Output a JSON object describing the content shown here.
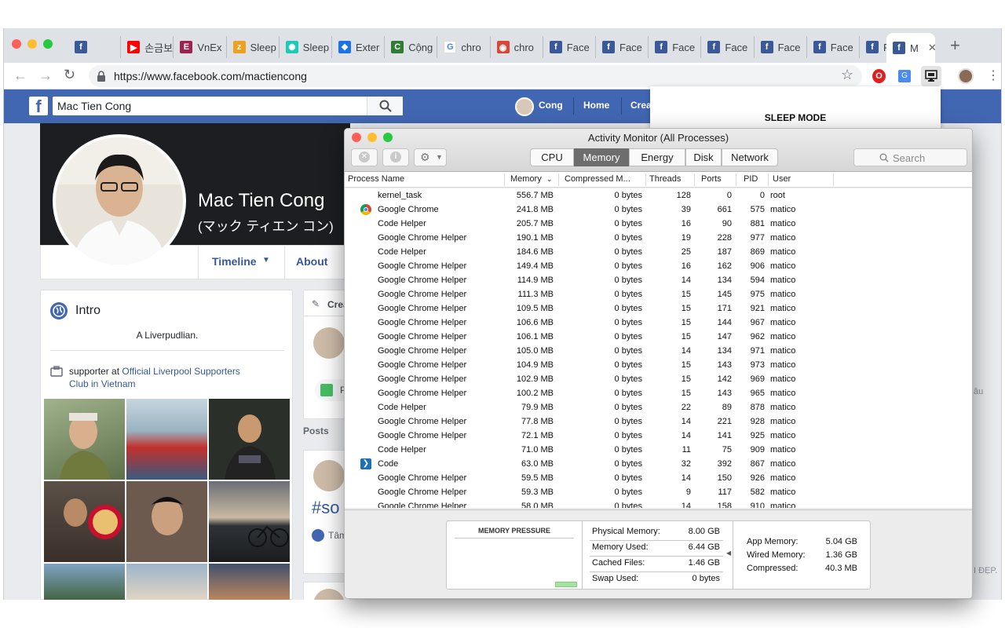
{
  "browser": {
    "tabs": [
      {
        "label": "",
        "icon": "facebook-icon"
      },
      {
        "label": "손금보",
        "icon": "youtube-icon"
      },
      {
        "label": "VnEx",
        "icon": "vnexpress-icon"
      },
      {
        "label": "Sleep",
        "icon": "sleep-app-icon"
      },
      {
        "label": "Sleep",
        "icon": "sleep-extension-icon"
      },
      {
        "label": "Exter",
        "icon": "puzzle-icon"
      },
      {
        "label": "Cộng",
        "icon": "cong-icon"
      },
      {
        "label": "chro",
        "icon": "google-icon"
      },
      {
        "label": "chro",
        "icon": "chrome-icon"
      },
      {
        "label": "Face",
        "icon": "facebook-icon"
      },
      {
        "label": "Face",
        "icon": "facebook-icon"
      },
      {
        "label": "Face",
        "icon": "facebook-icon"
      },
      {
        "label": "Face",
        "icon": "facebook-icon"
      },
      {
        "label": "Face",
        "icon": "facebook-icon"
      },
      {
        "label": "Face",
        "icon": "facebook-icon"
      },
      {
        "label": "Face",
        "icon": "facebook-icon"
      },
      {
        "label": "M",
        "icon": "facebook-icon",
        "active": true
      }
    ],
    "url": "https://www.facebook.com/mactiencong"
  },
  "facebook": {
    "search_value": "Mac Tien Cong",
    "nav": {
      "user": "Cong",
      "home": "Home",
      "create": "Crea"
    },
    "profile_name": "Mac Tien Cong",
    "profile_alt_name": "(マック ティエン コン)",
    "profile_tabs": {
      "timeline": "Timeline",
      "about": "About"
    },
    "intro": {
      "title": "Intro",
      "bio": "A Liverpudlian.",
      "supporter_prefix": "supporter at ",
      "supporter_link_1": "Official Liverpool Supporters",
      "supporter_link_2": "Club in Vietnam"
    },
    "create_post": "Crea",
    "photo_btn": "P",
    "posts_label": "Posts",
    "hashtag": "#so",
    "reaction": "Tâm",
    "right_frag_1": "âu",
    "right_frag_2": "I ĐẸP."
  },
  "sleep_popup": {
    "title": "SLEEP MODE"
  },
  "activity_monitor": {
    "title": "Activity Monitor (All Processes)",
    "tabs": [
      "CPU",
      "Memory",
      "Energy",
      "Disk",
      "Network"
    ],
    "selected_tab": "Memory",
    "search_placeholder": "Search",
    "columns": {
      "process": "Process Name",
      "memory": "Memory",
      "compressed": "Compressed M...",
      "threads": "Threads",
      "ports": "Ports",
      "pid": "PID",
      "user": "User"
    },
    "processes": [
      {
        "name": "kernel_task",
        "memory": "556.7 MB",
        "compressed": "0 bytes",
        "threads": "128",
        "ports": "0",
        "pid": "0",
        "user": "root",
        "icon": ""
      },
      {
        "name": "Google Chrome",
        "memory": "241.8 MB",
        "compressed": "0 bytes",
        "threads": "39",
        "ports": "661",
        "pid": "575",
        "user": "matico",
        "icon": "chrome-icon"
      },
      {
        "name": "Code Helper",
        "memory": "205.7 MB",
        "compressed": "0 bytes",
        "threads": "16",
        "ports": "90",
        "pid": "881",
        "user": "matico",
        "icon": ""
      },
      {
        "name": "Google Chrome Helper",
        "memory": "190.1 MB",
        "compressed": "0 bytes",
        "threads": "19",
        "ports": "228",
        "pid": "977",
        "user": "matico",
        "icon": ""
      },
      {
        "name": "Code Helper",
        "memory": "184.6 MB",
        "compressed": "0 bytes",
        "threads": "25",
        "ports": "187",
        "pid": "869",
        "user": "matico",
        "icon": ""
      },
      {
        "name": "Google Chrome Helper",
        "memory": "149.4 MB",
        "compressed": "0 bytes",
        "threads": "16",
        "ports": "162",
        "pid": "906",
        "user": "matico",
        "icon": ""
      },
      {
        "name": "Google Chrome Helper",
        "memory": "114.9 MB",
        "compressed": "0 bytes",
        "threads": "14",
        "ports": "134",
        "pid": "594",
        "user": "matico",
        "icon": ""
      },
      {
        "name": "Google Chrome Helper",
        "memory": "111.3 MB",
        "compressed": "0 bytes",
        "threads": "15",
        "ports": "145",
        "pid": "975",
        "user": "matico",
        "icon": ""
      },
      {
        "name": "Google Chrome Helper",
        "memory": "109.5 MB",
        "compressed": "0 bytes",
        "threads": "15",
        "ports": "171",
        "pid": "921",
        "user": "matico",
        "icon": ""
      },
      {
        "name": "Google Chrome Helper",
        "memory": "106.6 MB",
        "compressed": "0 bytes",
        "threads": "15",
        "ports": "144",
        "pid": "967",
        "user": "matico",
        "icon": ""
      },
      {
        "name": "Google Chrome Helper",
        "memory": "106.1 MB",
        "compressed": "0 bytes",
        "threads": "15",
        "ports": "147",
        "pid": "962",
        "user": "matico",
        "icon": ""
      },
      {
        "name": "Google Chrome Helper",
        "memory": "105.0 MB",
        "compressed": "0 bytes",
        "threads": "14",
        "ports": "134",
        "pid": "971",
        "user": "matico",
        "icon": ""
      },
      {
        "name": "Google Chrome Helper",
        "memory": "104.9 MB",
        "compressed": "0 bytes",
        "threads": "15",
        "ports": "143",
        "pid": "973",
        "user": "matico",
        "icon": ""
      },
      {
        "name": "Google Chrome Helper",
        "memory": "102.9 MB",
        "compressed": "0 bytes",
        "threads": "15",
        "ports": "142",
        "pid": "969",
        "user": "matico",
        "icon": ""
      },
      {
        "name": "Google Chrome Helper",
        "memory": "100.2 MB",
        "compressed": "0 bytes",
        "threads": "15",
        "ports": "143",
        "pid": "965",
        "user": "matico",
        "icon": ""
      },
      {
        "name": "Code Helper",
        "memory": "79.9 MB",
        "compressed": "0 bytes",
        "threads": "22",
        "ports": "89",
        "pid": "878",
        "user": "matico",
        "icon": ""
      },
      {
        "name": "Google Chrome Helper",
        "memory": "77.8 MB",
        "compressed": "0 bytes",
        "threads": "14",
        "ports": "221",
        "pid": "928",
        "user": "matico",
        "icon": ""
      },
      {
        "name": "Google Chrome Helper",
        "memory": "72.1 MB",
        "compressed": "0 bytes",
        "threads": "14",
        "ports": "141",
        "pid": "925",
        "user": "matico",
        "icon": ""
      },
      {
        "name": "Code Helper",
        "memory": "71.0 MB",
        "compressed": "0 bytes",
        "threads": "11",
        "ports": "75",
        "pid": "909",
        "user": "matico",
        "icon": ""
      },
      {
        "name": "Code",
        "memory": "63.0 MB",
        "compressed": "0 bytes",
        "threads": "32",
        "ports": "392",
        "pid": "867",
        "user": "matico",
        "icon": "vscode-icon"
      },
      {
        "name": "Google Chrome Helper",
        "memory": "59.5 MB",
        "compressed": "0 bytes",
        "threads": "14",
        "ports": "150",
        "pid": "926",
        "user": "matico",
        "icon": ""
      },
      {
        "name": "Google Chrome Helper",
        "memory": "59.3 MB",
        "compressed": "0 bytes",
        "threads": "9",
        "ports": "117",
        "pid": "582",
        "user": "matico",
        "icon": ""
      },
      {
        "name": "Google Chrome Helper",
        "memory": "58.0 MB",
        "compressed": "0 bytes",
        "threads": "14",
        "ports": "158",
        "pid": "910",
        "user": "matico",
        "icon": ""
      }
    ],
    "memory_pressure": {
      "label": "MEMORY PRESSURE",
      "level": 0.12,
      "color": "#a7e3a0"
    },
    "stats_left": [
      {
        "label": "Physical Memory:",
        "value": "8.00 GB"
      },
      {
        "label": "Memory Used:",
        "value": "6.44 GB"
      },
      {
        "label": "Cached Files:",
        "value": "1.46 GB"
      },
      {
        "label": "Swap Used:",
        "value": "0 bytes"
      }
    ],
    "stats_right": [
      {
        "label": "App Memory:",
        "value": "5.04 GB"
      },
      {
        "label": "Wired Memory:",
        "value": "1.36 GB"
      },
      {
        "label": "Compressed:",
        "value": "40.3 MB"
      }
    ]
  }
}
